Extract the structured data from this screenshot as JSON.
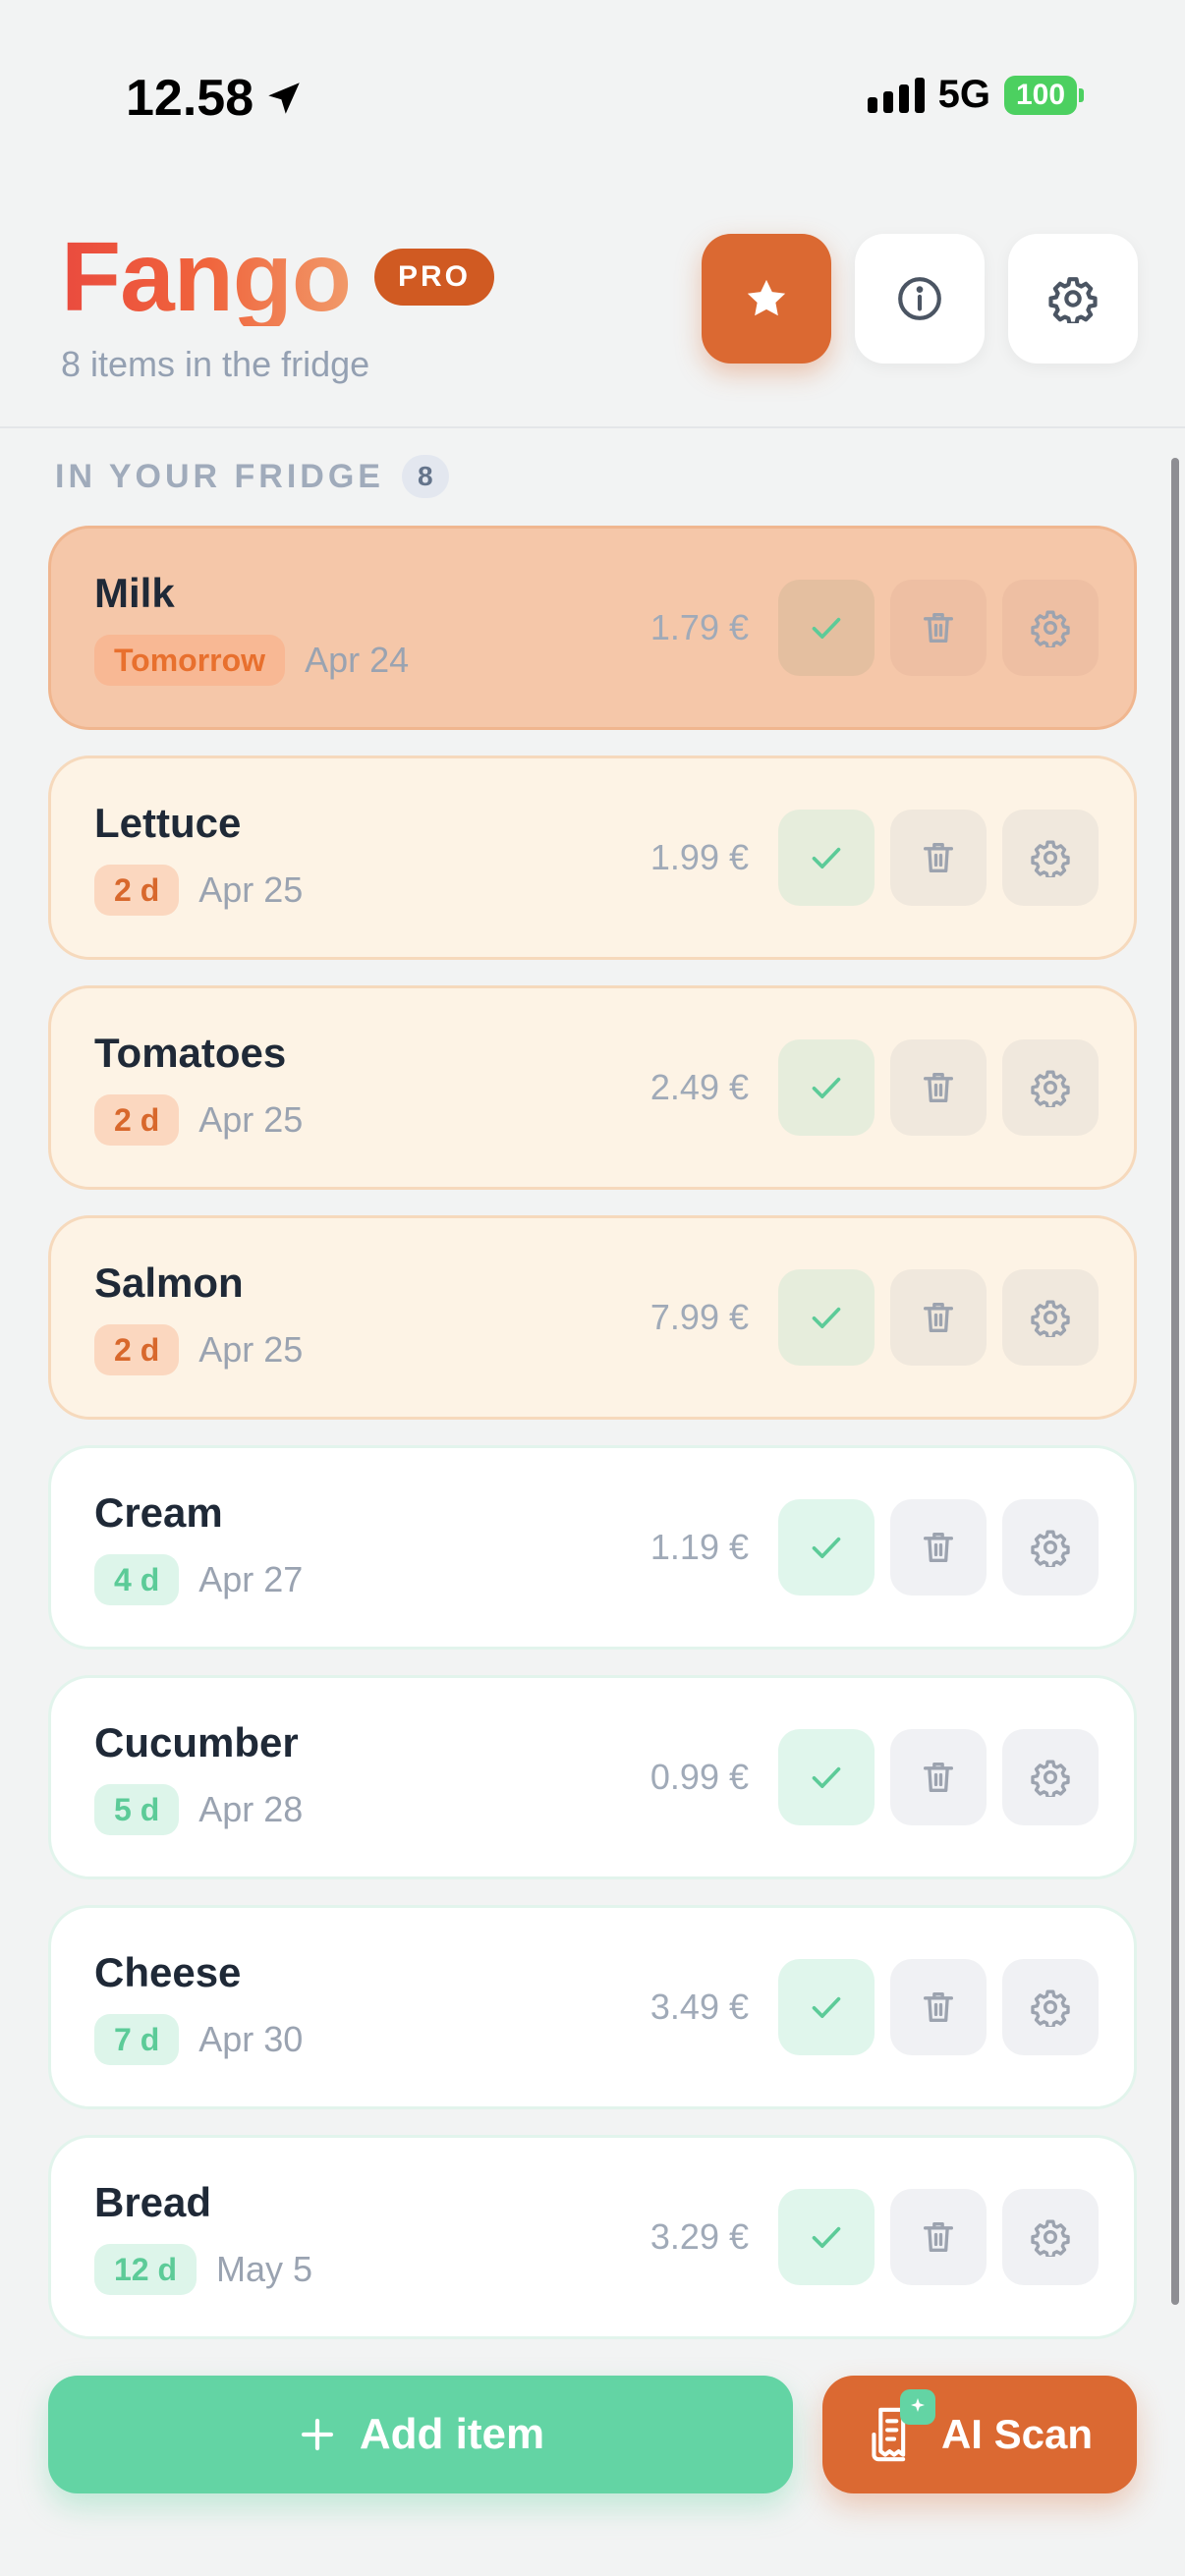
{
  "status_bar": {
    "time": "12.58",
    "network": "5G",
    "battery": "100"
  },
  "header": {
    "app_name": "Fango",
    "badge": "PRO",
    "subtitle": "8 items in the fridge"
  },
  "section": {
    "label": "IN YOUR FRIDGE",
    "count": "8"
  },
  "items": [
    {
      "name": "Milk",
      "days": "Tomorrow",
      "date": "Apr 24",
      "price": "1.79 €",
      "status": "urgent"
    },
    {
      "name": "Lettuce",
      "days": "2 d",
      "date": "Apr 25",
      "price": "1.99 €",
      "status": "soon"
    },
    {
      "name": "Tomatoes",
      "days": "2 d",
      "date": "Apr 25",
      "price": "2.49 €",
      "status": "soon"
    },
    {
      "name": "Salmon",
      "days": "2 d",
      "date": "Apr 25",
      "price": "7.99 €",
      "status": "soon"
    },
    {
      "name": "Cream",
      "days": "4 d",
      "date": "Apr 27",
      "price": "1.19 €",
      "status": "fresh"
    },
    {
      "name": "Cucumber",
      "days": "5 d",
      "date": "Apr 28",
      "price": "0.99 €",
      "status": "fresh"
    },
    {
      "name": "Cheese",
      "days": "7 d",
      "date": "Apr 30",
      "price": "3.49 €",
      "status": "fresh"
    },
    {
      "name": "Bread",
      "days": "12 d",
      "date": "May 5",
      "price": "3.29 €",
      "status": "fresh"
    }
  ],
  "actions": {
    "add_item": "Add item",
    "ai_scan": "AI Scan"
  },
  "colors": {
    "brand_orange": "#db6932",
    "accent_green": "#63d4a4",
    "urgent_bg": "#f5c7a9",
    "soon_bg": "#fdf3e5"
  },
  "icons": {
    "header": [
      "star-icon",
      "info-icon",
      "gear-icon"
    ],
    "row_actions": [
      "check-icon",
      "trash-icon",
      "gear-icon"
    ],
    "buttons": [
      "plus-icon",
      "receipt-icon",
      "sparkle-icon"
    ]
  }
}
